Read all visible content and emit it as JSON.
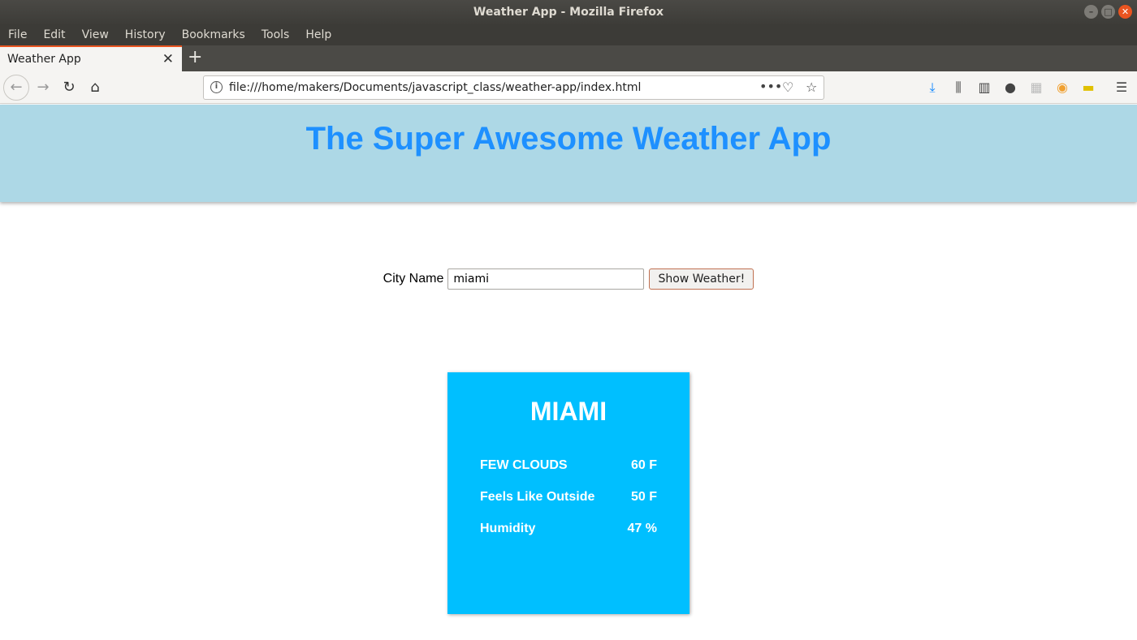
{
  "window": {
    "title": "Weather App - Mozilla Firefox"
  },
  "menu": [
    "File",
    "Edit",
    "View",
    "History",
    "Bookmarks",
    "Tools",
    "Help"
  ],
  "tab": {
    "title": "Weather App"
  },
  "urlbar": {
    "url": "file:///home/makers/Documents/javascript_class/weather-app/index.html"
  },
  "page": {
    "title": "The Super Awesome Weather App",
    "search": {
      "label": "City Name",
      "value": "miami",
      "button": "Show Weather!"
    },
    "card": {
      "city": "MIAMI",
      "rows": [
        {
          "label": "FEW CLOUDS",
          "value": "60 F"
        },
        {
          "label": "Feels Like Outside",
          "value": "50 F"
        },
        {
          "label": "Humidity",
          "value": "47 %"
        }
      ],
      "color": "#00bfff"
    },
    "header_color": "#add8e6",
    "title_color": "#1e90ff"
  }
}
